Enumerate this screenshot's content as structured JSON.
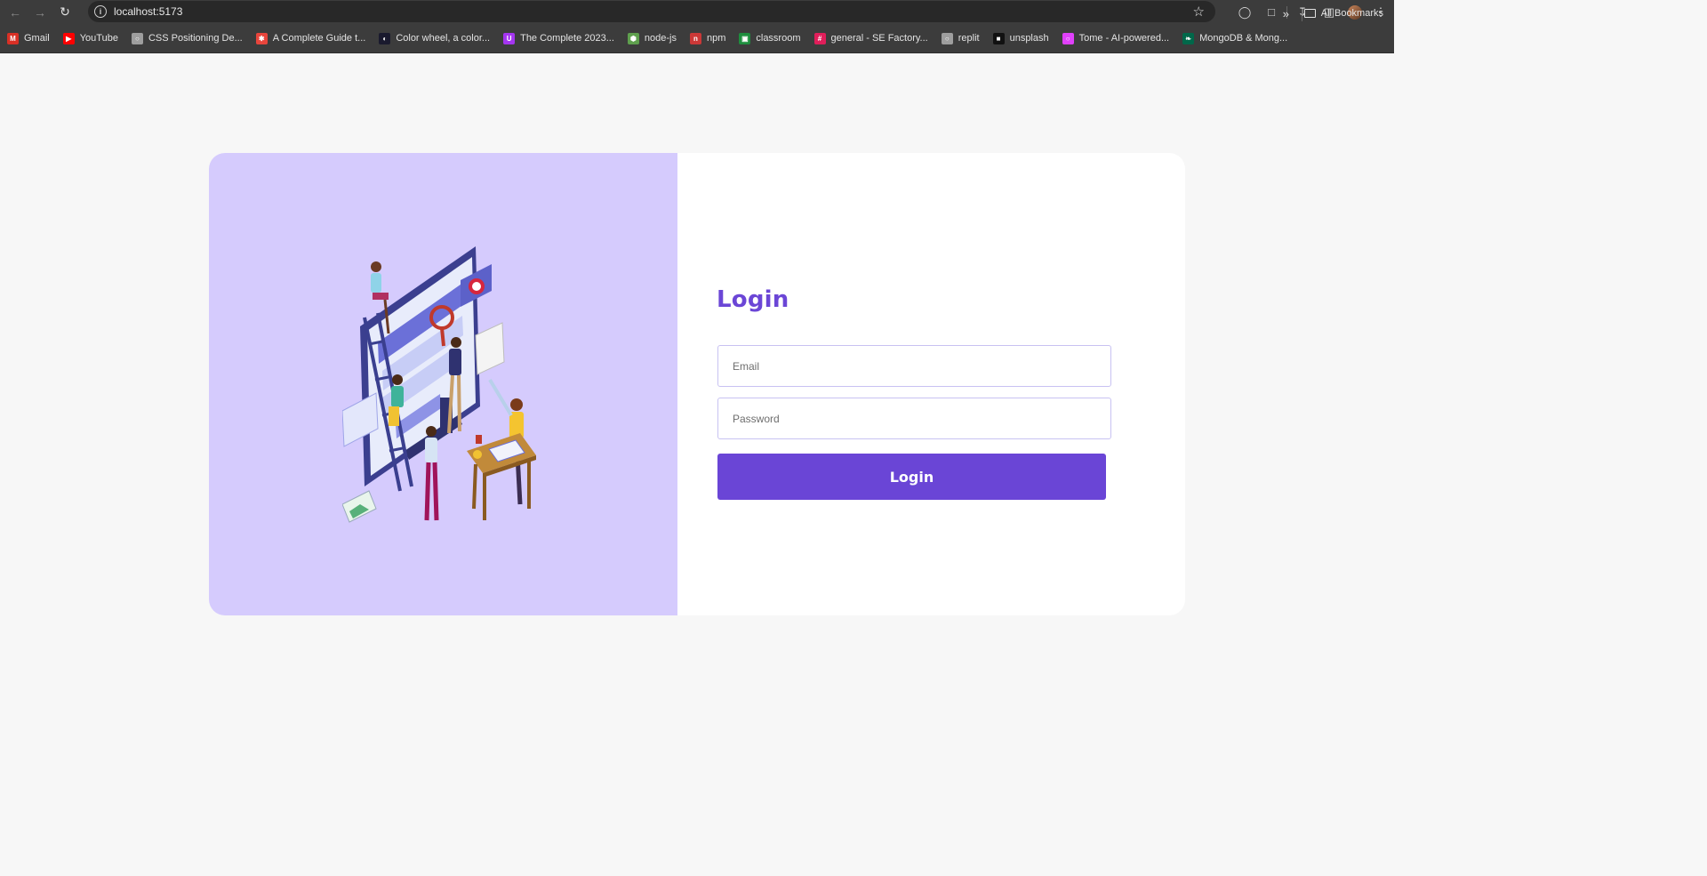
{
  "browser": {
    "url": "localhost:5173",
    "bookmarks": [
      {
        "label": "Gmail",
        "icon": "gmail-icon",
        "color": "#d93025"
      },
      {
        "label": "YouTube",
        "icon": "youtube-icon",
        "color": "#ff0000"
      },
      {
        "label": "CSS Positioning De...",
        "icon": "globe-icon",
        "color": "#9e9e9e"
      },
      {
        "label": "A Complete Guide t...",
        "icon": "asterisk-icon",
        "color": "#e8453c"
      },
      {
        "label": "Color wheel, a color...",
        "icon": "adobe-color-icon",
        "color": "#1a1a2e"
      },
      {
        "label": "The Complete 2023...",
        "icon": "udemy-icon",
        "color": "#a435f0"
      },
      {
        "label": "node-js",
        "icon": "nodejs-icon",
        "color": "#5fa04e"
      },
      {
        "label": "npm",
        "icon": "npm-icon",
        "color": "#cb3837"
      },
      {
        "label": "classroom",
        "icon": "classroom-icon",
        "color": "#1e8e3e"
      },
      {
        "label": "general - SE Factory...",
        "icon": "slack-icon",
        "color": "#e01e5a"
      },
      {
        "label": "replit",
        "icon": "globe-icon",
        "color": "#9e9e9e"
      },
      {
        "label": "unsplash",
        "icon": "unsplash-icon",
        "color": "#111111"
      },
      {
        "label": "Tome - AI-powered...",
        "icon": "tome-icon",
        "color": "#e040fb"
      },
      {
        "label": "MongoDB & Mong...",
        "icon": "mongodb-icon",
        "color": "#00684a"
      }
    ],
    "all_bookmarks": "All Bookmarks"
  },
  "login": {
    "title": "Login",
    "email_placeholder": "Email",
    "password_placeholder": "Password",
    "button_label": "Login"
  },
  "colors": {
    "accent": "#6a45d6",
    "panel": "#d5cbfd",
    "background": "#f7f7f7"
  }
}
